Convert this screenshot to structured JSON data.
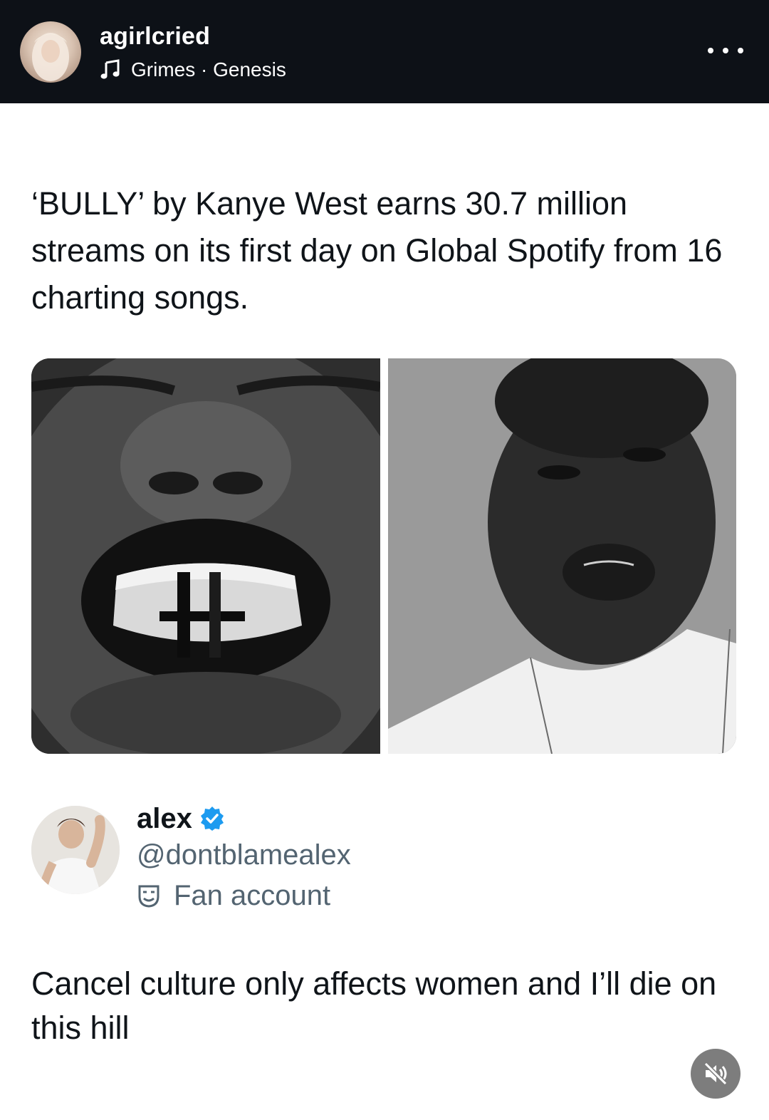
{
  "header": {
    "username": "agirlcried",
    "music": {
      "icon": "music-note-icon",
      "text": "Grimes · Genesis"
    },
    "more_icon": "more-horizontal-icon"
  },
  "tweet": {
    "text": "‘BULLY’ by Kanye West earns 30.7 million streams on its first day on Global Spotify from 16 charting songs."
  },
  "quoted": {
    "display_name": "alex",
    "verified_icon": "verified-badge-icon",
    "verified_color": "#1d9bf0",
    "handle": "@dontblamealex",
    "label_icon": "theater-mask-icon",
    "label": "Fan account",
    "text": "Cancel culture only affects women and I’ll die on this hill"
  },
  "controls": {
    "mute_icon": "speaker-muted-icon"
  },
  "colors": {
    "header_bg": "#0d1117",
    "text": "#0f1419",
    "secondary_text": "#536471"
  }
}
